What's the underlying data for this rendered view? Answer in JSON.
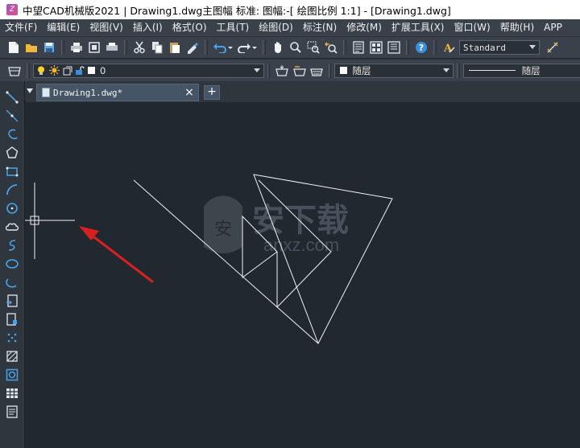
{
  "titlebar": {
    "title": "中望CAD机械版2021 | Drawing1.dwg主图幅  标准: 图幅:-[ 绘图比例 1:1] - [Drawing1.dwg]",
    "app_icon": "zwcad-logo-icon"
  },
  "menu": {
    "items": [
      "文件(F)",
      "编辑(E)",
      "视图(V)",
      "插入(I)",
      "格式(O)",
      "工具(T)",
      "绘图(D)",
      "标注(N)",
      "修改(M)",
      "扩展工具(X)",
      "窗口(W)",
      "帮助(H)",
      "APP"
    ]
  },
  "toolbar": {
    "text_style": "Standard",
    "layer_name": "0",
    "color_value": "随层",
    "linetype_value": "随层"
  },
  "tabs": {
    "active_label": "Drawing1.dwg*"
  },
  "watermark": {
    "cn": "安下载",
    "url": "anxz.com",
    "badge": "安"
  },
  "colors": {
    "canvas": "#212830",
    "panel": "#3a414b",
    "accent": "#4aa3e8",
    "arrow": "#d92020"
  }
}
